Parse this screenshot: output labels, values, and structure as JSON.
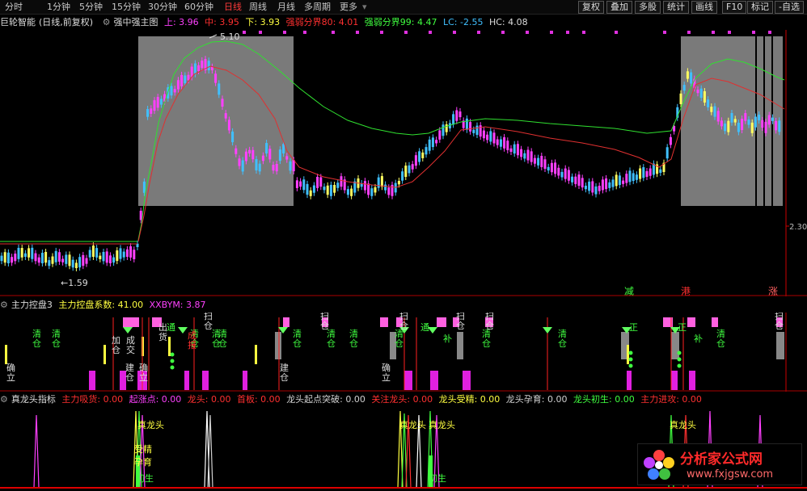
{
  "toolbar": {
    "periods": [
      "分时",
      "1分钟",
      "5分钟",
      "15分钟",
      "30分钟",
      "60分钟",
      "日线",
      "周线",
      "月线",
      "多周期",
      "更多"
    ],
    "active": "日线",
    "right": [
      "复权",
      "叠加",
      "多股",
      "统计",
      "画线",
      "F10",
      "标记",
      "-自选"
    ]
  },
  "main": {
    "app": "巨轮智能",
    "mode": "(日线,前复权)",
    "indicator": "强中强主图",
    "up": "上: 3.96",
    "mid": "中: 3.95",
    "down": "下: 3.93",
    "s80": "强弱分界80: 4.01",
    "s99": "强弱分界99: 4.47",
    "lc": "LC: -2.55",
    "hc": "HC: 4.08",
    "high_label": "5.10",
    "low_label": "1.59",
    "axis_label": "2.30",
    "markers": [
      "减",
      "港",
      "涨"
    ]
  },
  "panel2": {
    "name": "主力控盘3",
    "coef": "主力控盘系数: 41.00",
    "xx": "XXBYM: 3.87",
    "labels": {
      "qing": "清仓",
      "sao": "扫仓",
      "queli": "确立",
      "jiancang": "建仓",
      "jiacang": "加仓",
      "chengjiao": "成交",
      "chuhuo": "出货",
      "tong": "通",
      "zheng": "正",
      "bu": "补",
      "chengbao": "成报"
    }
  },
  "panel3": {
    "name": "真龙头指标",
    "items": [
      {
        "label": "主力吸货: 0.00",
        "color": "#ff3030"
      },
      {
        "label": "起涨点: 0.00",
        "color": "#ff40ff"
      },
      {
        "label": "龙头: 0.00",
        "color": "#ff3030"
      },
      {
        "label": "首板: 0.00",
        "color": "#ff3030"
      },
      {
        "label": "龙头起点突破: 0.00",
        "color": "#d0d0d0"
      },
      {
        "label": "关注龙头: 0.00",
        "color": "#ff3030"
      },
      {
        "label": "龙头受精: 0.00",
        "color": "#ffff40"
      },
      {
        "label": "龙头孕育: 0.00",
        "color": "#d0d0d0"
      },
      {
        "label": "龙头初生: 0.00",
        "color": "#40ff40"
      },
      {
        "label": "主力进攻: 0.00",
        "color": "#ff3030"
      }
    ],
    "labels": {
      "zhenlongtou": "真龙头",
      "chusheng": "初生",
      "shoujing": "受精",
      "yunyu": "孕育"
    }
  },
  "watermark": {
    "title": "分析家公式网",
    "url": "www.fxjgsw.com"
  }
}
